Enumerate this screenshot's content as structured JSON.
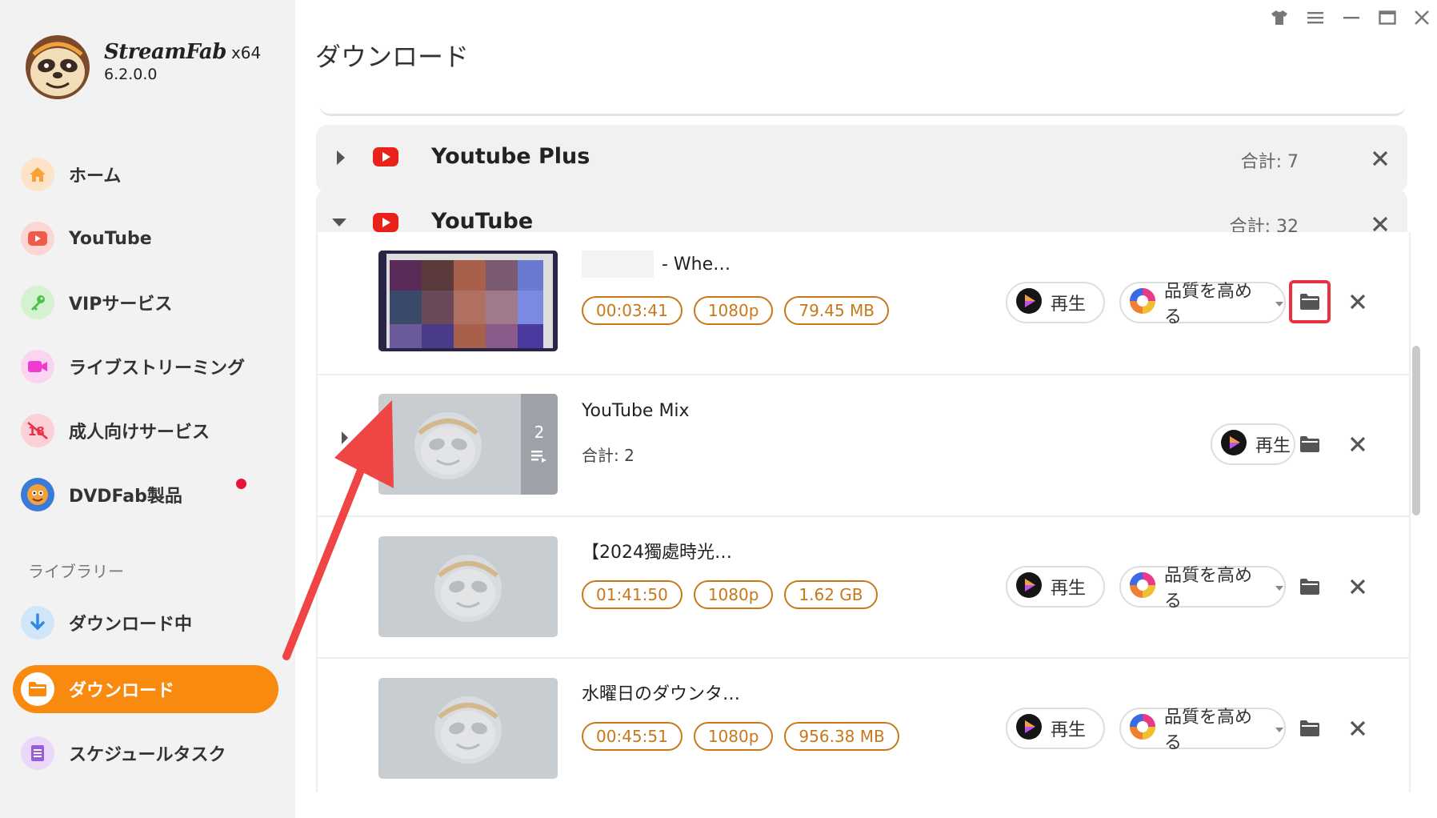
{
  "app": {
    "name": "StreamFab",
    "arch": "x64",
    "version": "6.2.0.0"
  },
  "window_controls": [
    "skin-icon",
    "menu-icon",
    "minimize-icon",
    "maximize-icon",
    "close-icon"
  ],
  "sidebar": {
    "items": [
      {
        "label": "ホーム",
        "icon": "home-icon",
        "color": "#f9a23a"
      },
      {
        "label": "YouTube",
        "icon": "youtube-icon",
        "color": "#f05a4a"
      },
      {
        "label": "VIPサービス",
        "icon": "key-icon",
        "color": "#4cc24a"
      },
      {
        "label": "ライブストリーミング",
        "icon": "camera-icon",
        "color": "#f03ad0"
      },
      {
        "label": "成人向けサービス",
        "icon": "adult-icon",
        "color": "#e8324a"
      },
      {
        "label": "DVDFab製品",
        "icon": "dvdfab-icon",
        "color": "#3a7ad8"
      }
    ],
    "library_label": "ライブラリー",
    "library_items": [
      {
        "label": "ダウンロード中",
        "icon": "download-arrow-icon",
        "color": "#2e8ae6"
      },
      {
        "label": "ダウンロード",
        "icon": "folder-icon",
        "color": "#ffffff",
        "active": true
      },
      {
        "label": "スケジュールタスク",
        "icon": "schedule-icon",
        "color": "#9b5cd8"
      }
    ]
  },
  "page_title": "ダウンロード",
  "groups": [
    {
      "name": "Youtube Plus",
      "total": "合計: 7",
      "expanded": false
    },
    {
      "name": "YouTube",
      "total": "合計: 32",
      "expanded": true
    }
  ],
  "items": [
    {
      "title": "- Whe…",
      "duration": "00:03:41",
      "quality": "1080p",
      "size": "79.45 MB",
      "play": "再生",
      "enhance": "品質を高める",
      "thumb": "video-thumbnail",
      "folder_highlighted": true
    },
    {
      "title": "YouTube Mix",
      "total": "合計: 2",
      "count": "2",
      "play": "再生",
      "thumb": "playlist-thumbnail"
    },
    {
      "title": "【2024獨處時光…",
      "duration": "01:41:50",
      "quality": "1080p",
      "size": "1.62 GB",
      "play": "再生",
      "enhance": "品質を高める",
      "thumb": "placeholder-thumbnail"
    },
    {
      "title": "水曜日のダウンタ…",
      "duration": "00:45:51",
      "quality": "1080p",
      "size": "956.38 MB",
      "play": "再生",
      "enhance": "品質を高める",
      "thumb": "placeholder-thumbnail"
    }
  ],
  "colors": {
    "accent": "#f98a10",
    "tag": "#c8781a",
    "highlight": "#e8323f",
    "annotation_arrow": "#f04545"
  }
}
